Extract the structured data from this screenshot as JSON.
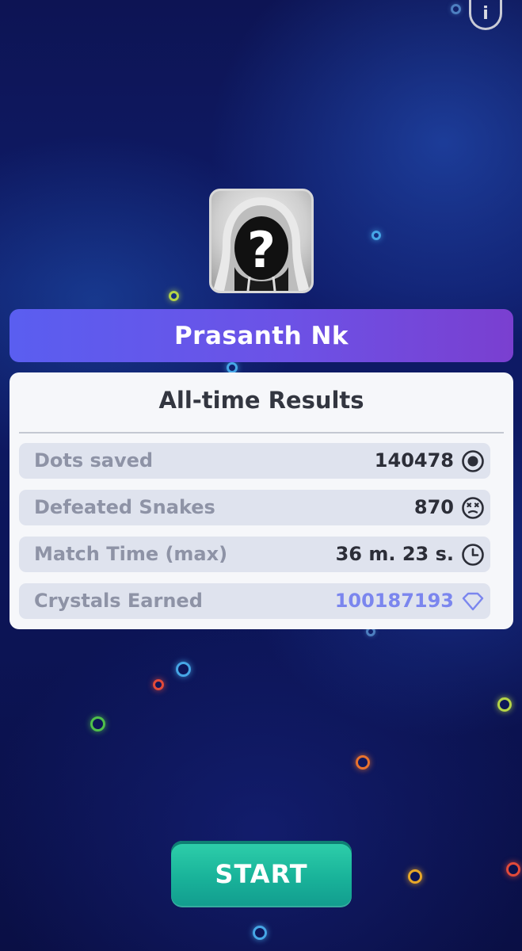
{
  "header": {
    "info_icon": "info-icon",
    "info_symbol": "i"
  },
  "profile": {
    "avatar_icon": "hooded-mystery-avatar-icon",
    "player_name": "Prasanth Nk"
  },
  "results": {
    "title": "All-time Results",
    "stats": [
      {
        "label": "Dots saved",
        "value": "140478",
        "icon": "dot-target-icon"
      },
      {
        "label": "Defeated Snakes",
        "value": "870",
        "icon": "dizzy-face-icon"
      },
      {
        "label": "Match Time (max)",
        "value": "36 m. 23 s.",
        "icon": "clock-icon"
      },
      {
        "label": "Crystals Earned",
        "value": "100187193",
        "icon": "diamond-icon",
        "color": "#7b86ee"
      }
    ]
  },
  "actions": {
    "start_label": "START"
  },
  "colors": {
    "banner_gradient": [
      "#5a5ef0",
      "#7a3fd0"
    ],
    "start_button": "#19b39a",
    "card_background": "#f6f7fa",
    "row_background": "#dfe3ee"
  }
}
